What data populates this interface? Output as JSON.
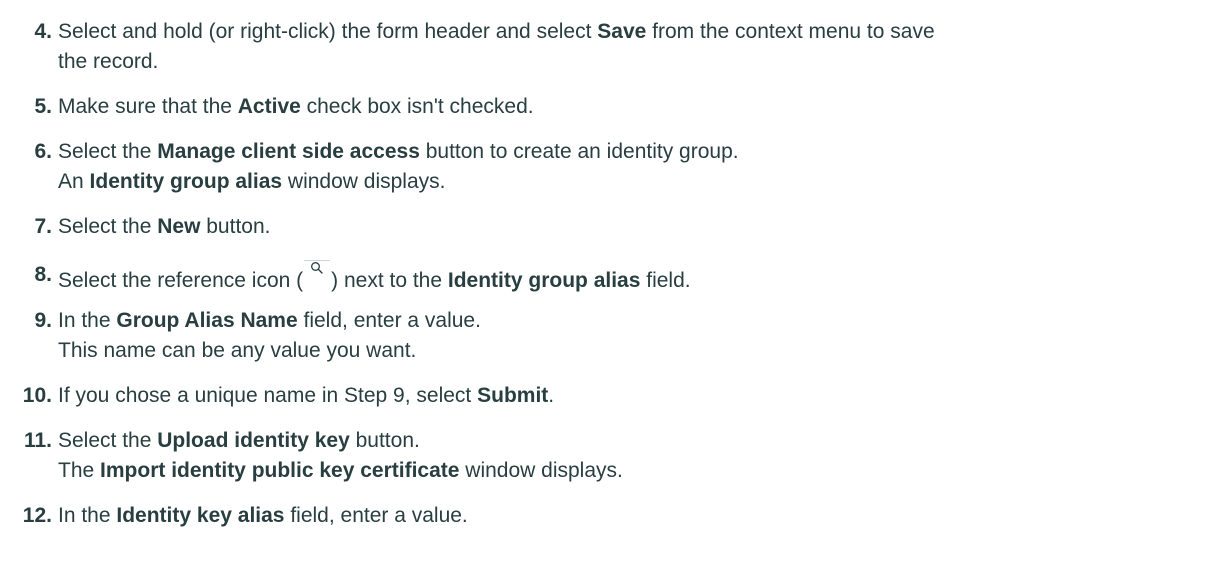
{
  "steps": [
    {
      "number": "4.",
      "line1": {
        "before": "Select and hold (or right-click) the form header and select ",
        "bold": "Save",
        "after": " from the context menu to save"
      },
      "line2": "the record."
    },
    {
      "number": "5.",
      "line1": {
        "before": "Make sure that the ",
        "bold": "Active",
        "after": " check box isn't checked."
      }
    },
    {
      "number": "6.",
      "line1": {
        "before": "Select the ",
        "bold": "Manage client side access",
        "after": " button to create an identity group."
      },
      "line2": {
        "before": "An ",
        "bold": "Identity group alias",
        "after": " window displays."
      }
    },
    {
      "number": "7.",
      "line1": {
        "before": "Select the ",
        "bold": "New",
        "after": " button."
      }
    },
    {
      "number": "8.",
      "line1": {
        "before": "Select the reference icon (",
        "icon": "magnifier-icon",
        "middle": ") next to the ",
        "bold": "Identity group alias",
        "after": " field."
      }
    },
    {
      "number": "9.",
      "line1": {
        "before": "In the ",
        "bold": "Group Alias Name",
        "after": " field, enter a value."
      },
      "line2": "This name can be any value you want."
    },
    {
      "number": "10.",
      "line1": {
        "before": "If you chose a unique name in Step 9, select ",
        "bold": "Submit",
        "after": "."
      }
    },
    {
      "number": "11.",
      "line1": {
        "before": "Select the ",
        "bold": "Upload identity key",
        "after": " button."
      },
      "line2": {
        "before": "The ",
        "bold": "Import identity public key certificate",
        "after": " window displays."
      }
    },
    {
      "number": "12.",
      "line1": {
        "before": "In the ",
        "bold": "Identity key alias",
        "after": " field, enter a value."
      }
    }
  ]
}
